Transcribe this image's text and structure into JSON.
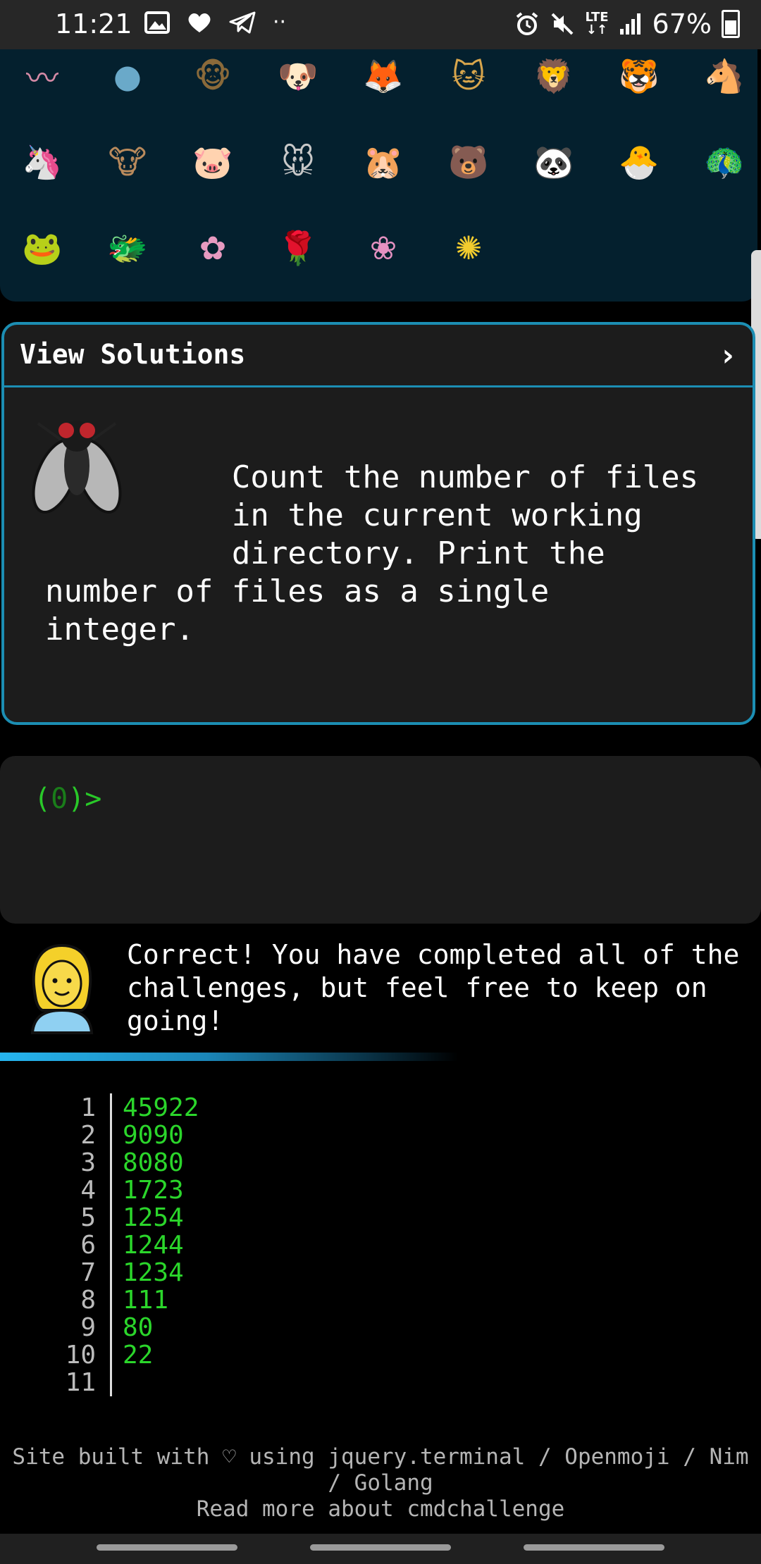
{
  "status": {
    "time": "11:21",
    "battery": "67%",
    "network": "LTE"
  },
  "emojis": [
    {
      "name": "worm",
      "glyph": "〰",
      "color": "#d58aa6"
    },
    {
      "name": "microbe",
      "glyph": "●",
      "color": "#6aa9c9"
    },
    {
      "name": "monkey",
      "glyph": "🐵",
      "color": "#8a6a3a"
    },
    {
      "name": "dog",
      "glyph": "🐶",
      "color": "#d9a24a"
    },
    {
      "name": "fox",
      "glyph": "🦊",
      "color": "#d06b2e"
    },
    {
      "name": "cat",
      "glyph": "🐱",
      "color": "#d8a54c"
    },
    {
      "name": "lion",
      "glyph": "🦁",
      "color": "#d79a2f"
    },
    {
      "name": "tiger",
      "glyph": "🐯",
      "color": "#e08a2a"
    },
    {
      "name": "horse",
      "glyph": "🐴",
      "color": "#8b5a2b"
    },
    {
      "name": "unicorn",
      "glyph": "🦄",
      "color": "#f0f0f0"
    },
    {
      "name": "cow",
      "glyph": "🐮",
      "color": "#b98a5c"
    },
    {
      "name": "pig",
      "glyph": "🐷",
      "color": "#f2a5b8"
    },
    {
      "name": "mouse",
      "glyph": "🐭",
      "color": "#c8c8c8"
    },
    {
      "name": "hamster",
      "glyph": "🐹",
      "color": "#d8914a"
    },
    {
      "name": "bear",
      "glyph": "🐻",
      "color": "#7a5030"
    },
    {
      "name": "panda",
      "glyph": "🐼",
      "color": "#efefef"
    },
    {
      "name": "chick",
      "glyph": "🐣",
      "color": "#f5d94a"
    },
    {
      "name": "peacock",
      "glyph": "🦚",
      "color": "#2a8f5a"
    },
    {
      "name": "frog",
      "glyph": "🐸",
      "color": "#8cc63f"
    },
    {
      "name": "dragon",
      "glyph": "🐲",
      "color": "#3d9b4a"
    },
    {
      "name": "blossom",
      "glyph": "✿",
      "color": "#e79ac0"
    },
    {
      "name": "rose",
      "glyph": "🌹",
      "color": "#d63031"
    },
    {
      "name": "hibiscus",
      "glyph": "❀",
      "color": "#e591c1"
    },
    {
      "name": "sunflower",
      "glyph": "✺",
      "color": "#f2cc2e"
    }
  ],
  "card": {
    "title": "View Solutions",
    "chevron": "›",
    "challenge": "          Count the number of files\n          in the current working\n          directory. Print the\nnumber of files as a single\ninteger."
  },
  "terminal": {
    "prompt_open": "(",
    "prompt_count": "0",
    "prompt_close": ")>"
  },
  "message": "Correct! You have completed all of the challenges, but feel free to keep on going!",
  "scores": [
    {
      "rank": "1",
      "value": "45922"
    },
    {
      "rank": "2",
      "value": "9090"
    },
    {
      "rank": "3",
      "value": "8080"
    },
    {
      "rank": "4",
      "value": "1723"
    },
    {
      "rank": "5",
      "value": "1254"
    },
    {
      "rank": "6",
      "value": "1244"
    },
    {
      "rank": "7",
      "value": "1234"
    },
    {
      "rank": "8",
      "value": "111"
    },
    {
      "rank": "9",
      "value": "80"
    },
    {
      "rank": "10",
      "value": "22"
    },
    {
      "rank": "11",
      "value": ""
    }
  ],
  "footer": {
    "line1": "Site built with ♡ using jquery.terminal / Openmoji / Nim / Golang",
    "line2": "Read more about cmdchallenge"
  }
}
